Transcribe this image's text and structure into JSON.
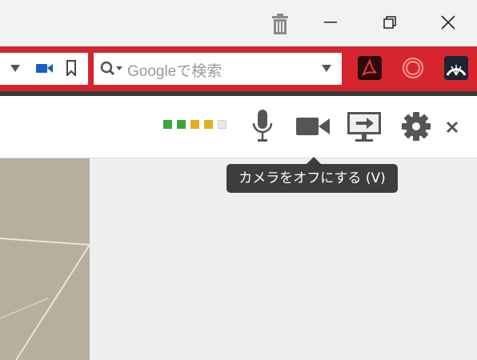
{
  "window": {
    "trash_icon": "trash-icon",
    "minimize_icon": "minimize-icon",
    "restore_icon": "restore-icon",
    "close_icon": "close-icon"
  },
  "browser_toolbar": {
    "accent_color": "#d6252f",
    "search": {
      "placeholder": "Googleで検索"
    },
    "extensions": [
      "acrobat-icon",
      "record-icon",
      "speed-dial-icon"
    ]
  },
  "call_controls": {
    "signal_colors": [
      "#3aa63a",
      "#3aa63a",
      "#e0b020",
      "#e0b020",
      "#e8e8e8"
    ],
    "buttons": [
      "microphone-icon",
      "camera-icon",
      "screen-share-icon",
      "settings-icon",
      "close-icon"
    ]
  },
  "tooltip": {
    "text": "カメラをオフにする (V)"
  }
}
